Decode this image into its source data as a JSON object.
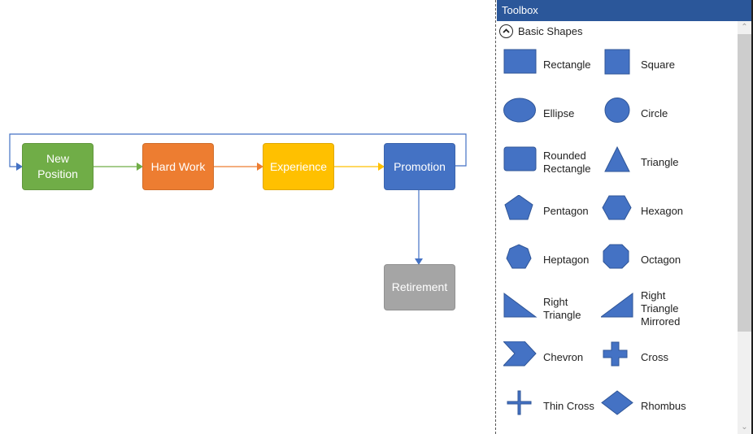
{
  "diagram": {
    "nodes": [
      {
        "id": "new-position",
        "label": "New\nPosition",
        "color": "#70ad47"
      },
      {
        "id": "hard-work",
        "label": "Hard Work",
        "color": "#ed7d31"
      },
      {
        "id": "experience",
        "label": "Experience",
        "color": "#ffc000"
      },
      {
        "id": "promotion",
        "label": "Promotion",
        "color": "#4472c4"
      },
      {
        "id": "retirement",
        "label": "Retirement",
        "color": "#a5a5a5"
      }
    ],
    "connectors": [
      {
        "from": "new-position",
        "to": "hard-work",
        "color": "#70ad47"
      },
      {
        "from": "hard-work",
        "to": "experience",
        "color": "#ed7d31"
      },
      {
        "from": "experience",
        "to": "promotion",
        "color": "#ffc000"
      },
      {
        "from": "promotion",
        "to": "new-position",
        "color": "#4472c4"
      },
      {
        "from": "promotion",
        "to": "retirement",
        "color": "#4472c4"
      }
    ]
  },
  "toolbox": {
    "title": "Toolbox",
    "group": {
      "label": "Basic Shapes",
      "icon": "chevron-up-circle-icon",
      "shapes": [
        {
          "name": "rectangle",
          "label": "Rectangle"
        },
        {
          "name": "square",
          "label": "Square"
        },
        {
          "name": "ellipse",
          "label": "Ellipse"
        },
        {
          "name": "circle",
          "label": "Circle"
        },
        {
          "name": "rounded-rectangle",
          "label": "Rounded\nRectangle"
        },
        {
          "name": "triangle",
          "label": "Triangle"
        },
        {
          "name": "pentagon",
          "label": "Pentagon"
        },
        {
          "name": "hexagon",
          "label": "Hexagon"
        },
        {
          "name": "heptagon",
          "label": "Heptagon"
        },
        {
          "name": "octagon",
          "label": "Octagon"
        },
        {
          "name": "right-triangle",
          "label": "Right\nTriangle"
        },
        {
          "name": "right-triangle-mirrored",
          "label": "Right\nTriangle\nMirrored"
        },
        {
          "name": "chevron",
          "label": "Chevron"
        },
        {
          "name": "cross",
          "label": "Cross"
        },
        {
          "name": "thin-cross",
          "label": "Thin Cross"
        },
        {
          "name": "rhombus",
          "label": "Rhombus"
        }
      ]
    },
    "shape_fill": "#4472c4",
    "shape_stroke": "#2f5597",
    "header_color": "#2b579a",
    "scroll_up_icon": "chevron-up-icon",
    "scroll_down_icon": "chevron-down-icon"
  }
}
